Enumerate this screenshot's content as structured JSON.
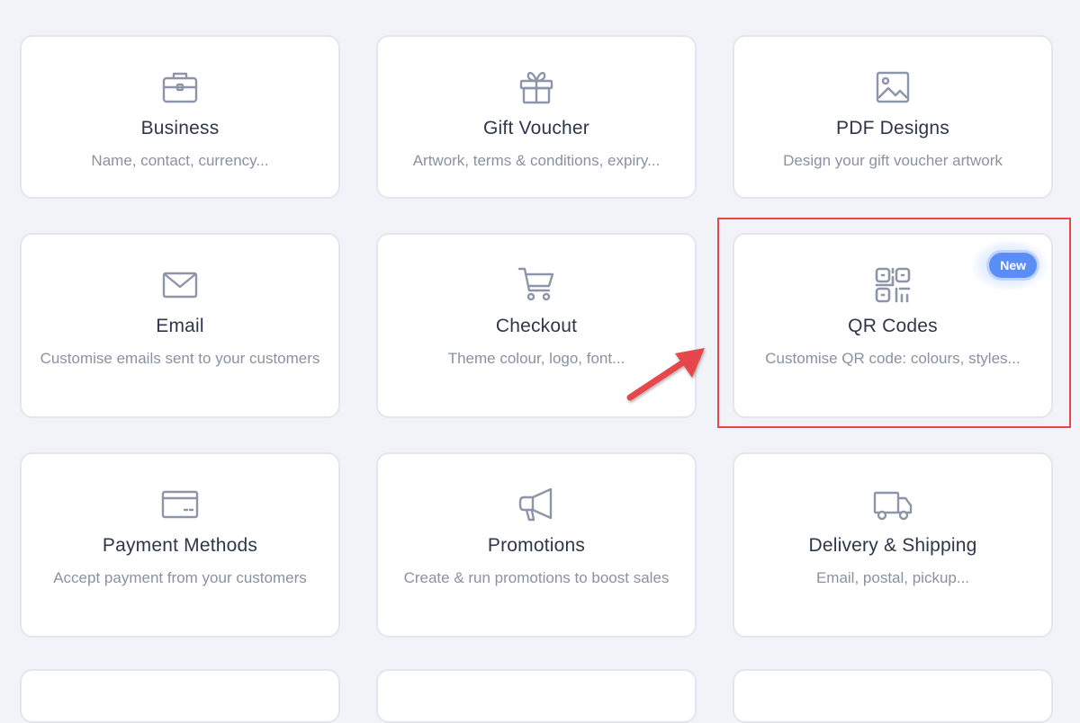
{
  "cards": [
    {
      "title": "Business",
      "desc": "Name, contact, currency...",
      "icon": "briefcase-icon"
    },
    {
      "title": "Gift Voucher",
      "desc": "Artwork, terms & conditions, expiry...",
      "icon": "gift-icon"
    },
    {
      "title": "PDF Designs",
      "desc": "Design your gift voucher artwork",
      "icon": "image-icon"
    },
    {
      "title": "Email",
      "desc": "Customise emails sent to your customers",
      "icon": "envelope-icon"
    },
    {
      "title": "Checkout",
      "desc": "Theme colour, logo, font...",
      "icon": "cart-icon"
    },
    {
      "title": "QR Codes",
      "desc": "Customise QR code: colours, styles...",
      "icon": "qr-code-icon",
      "badge": "New"
    },
    {
      "title": "Payment Methods",
      "desc": "Accept payment from your customers",
      "icon": "credit-card-icon"
    },
    {
      "title": "Promotions",
      "desc": "Create & run promotions to boost sales",
      "icon": "megaphone-icon"
    },
    {
      "title": "Delivery & Shipping",
      "desc": "Email, postal, pickup...",
      "icon": "truck-icon"
    }
  ],
  "colors": {
    "background": "#f1f3f8",
    "icon": "#8d96a8",
    "badge": "#5b8df6",
    "annotation": "#e5474b"
  }
}
